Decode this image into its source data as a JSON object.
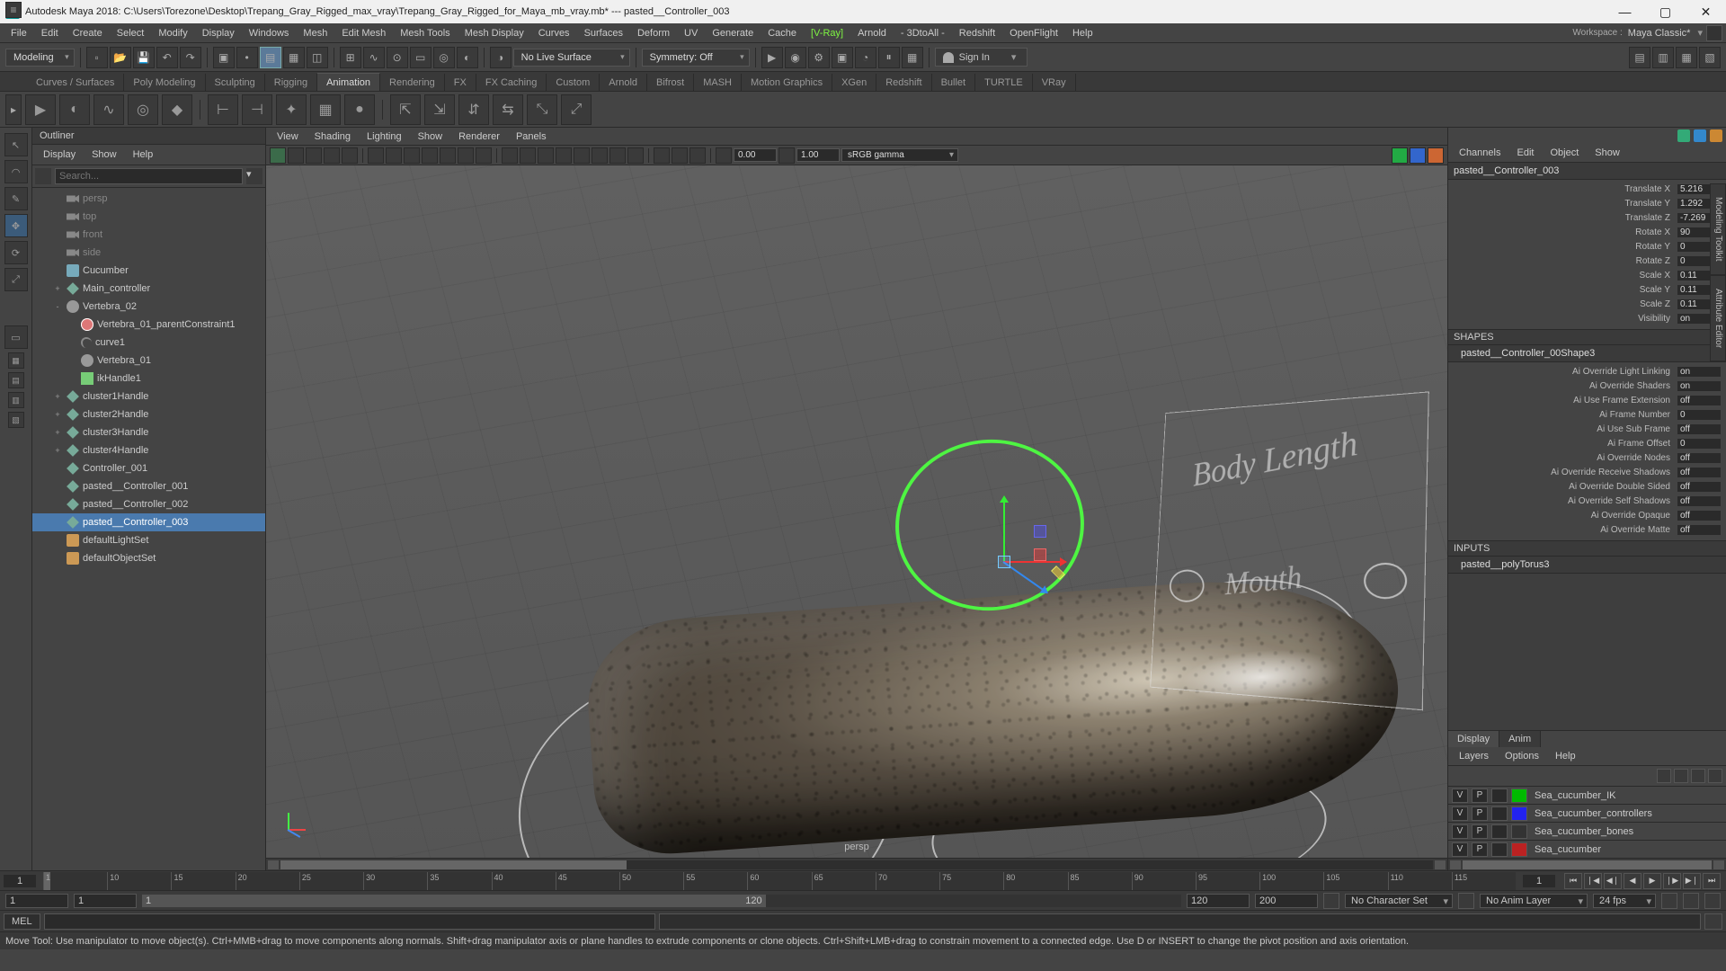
{
  "title": "Autodesk Maya 2018: C:\\Users\\Torezone\\Desktop\\Trepang_Gray_Rigged_max_vray\\Trepang_Gray_Rigged_for_Maya_mb_vray.mb*   ---   pasted__Controller_003",
  "menubar": [
    "File",
    "Edit",
    "Create",
    "Select",
    "Modify",
    "Display",
    "Windows",
    "Mesh",
    "Edit Mesh",
    "Mesh Tools",
    "Mesh Display",
    "Curves",
    "Surfaces",
    "Deform",
    "UV",
    "Generate",
    "Cache",
    "[V-Ray]",
    "Arnold",
    "- 3DtoAll -",
    "Redshift",
    "OpenFlight",
    "Help"
  ],
  "workspace": {
    "label": "Workspace :",
    "value": "Maya Classic*"
  },
  "modeMenu": "Modeling",
  "liveSurface": "No Live Surface",
  "symmetry": "Symmetry: Off",
  "signIn": "Sign In",
  "shelfTabs": [
    "Curves / Surfaces",
    "Poly Modeling",
    "Sculpting",
    "Rigging",
    "Animation",
    "Rendering",
    "FX",
    "FX Caching",
    "Custom",
    "Arnold",
    "Bifrost",
    "MASH",
    "Motion Graphics",
    "XGen",
    "Redshift",
    "Bullet",
    "TURTLE",
    "VRay"
  ],
  "shelfActive": "Animation",
  "outliner": {
    "title": "Outliner",
    "menu": [
      "Display",
      "Show",
      "Help"
    ],
    "searchPlaceholder": "Search...",
    "nodes": [
      {
        "icon": "cam",
        "label": "persp",
        "dim": true,
        "indent": 1
      },
      {
        "icon": "cam",
        "label": "top",
        "dim": true,
        "indent": 1
      },
      {
        "icon": "cam",
        "label": "front",
        "dim": true,
        "indent": 1
      },
      {
        "icon": "cam",
        "label": "side",
        "dim": true,
        "indent": 1
      },
      {
        "icon": "mesh",
        "label": "Cucumber",
        "indent": 1
      },
      {
        "icon": "loc",
        "label": "Main_controller",
        "indent": 1,
        "exp": "+"
      },
      {
        "icon": "jnt",
        "label": "Vertebra_02",
        "indent": 1,
        "exp": "-"
      },
      {
        "icon": "con",
        "label": "Vertebra_01_parentConstraint1",
        "indent": 2
      },
      {
        "icon": "crv",
        "label": "curve1",
        "indent": 2
      },
      {
        "icon": "jnt",
        "label": "Vertebra_01",
        "indent": 2
      },
      {
        "icon": "ik",
        "label": "ikHandle1",
        "indent": 2
      },
      {
        "icon": "loc",
        "label": "cluster1Handle",
        "indent": 1,
        "exp": "+"
      },
      {
        "icon": "loc",
        "label": "cluster2Handle",
        "indent": 1,
        "exp": "+"
      },
      {
        "icon": "loc",
        "label": "cluster3Handle",
        "indent": 1,
        "exp": "+"
      },
      {
        "icon": "loc",
        "label": "cluster4Handle",
        "indent": 1,
        "exp": "+"
      },
      {
        "icon": "loc",
        "label": "Controller_001",
        "indent": 1
      },
      {
        "icon": "loc",
        "label": "pasted__Controller_001",
        "indent": 1
      },
      {
        "icon": "loc",
        "label": "pasted__Controller_002",
        "indent": 1
      },
      {
        "icon": "loc",
        "label": "pasted__Controller_003",
        "indent": 1,
        "sel": true
      },
      {
        "icon": "set",
        "label": "defaultLightSet",
        "indent": 1
      },
      {
        "icon": "set",
        "label": "defaultObjectSet",
        "indent": 1
      }
    ]
  },
  "viewportMenu": [
    "View",
    "Shading",
    "Lighting",
    "Show",
    "Renderer",
    "Panels"
  ],
  "viewportFields": {
    "f1": "0.00",
    "f2": "1.00",
    "colorspace": "sRGB gamma"
  },
  "viewportLabels": {
    "bodyLength": "Body Length",
    "mouth": "Mouth"
  },
  "viewportCamera": "persp",
  "channelBox": {
    "menu": [
      "Channels",
      "Edit",
      "Object",
      "Show"
    ],
    "node": "pasted__Controller_003",
    "attrs": [
      {
        "n": "Translate X",
        "v": "5.216"
      },
      {
        "n": "Translate Y",
        "v": "1.292"
      },
      {
        "n": "Translate Z",
        "v": "-7.269"
      },
      {
        "n": "Rotate X",
        "v": "90"
      },
      {
        "n": "Rotate Y",
        "v": "0"
      },
      {
        "n": "Rotate Z",
        "v": "0"
      },
      {
        "n": "Scale X",
        "v": "0.11"
      },
      {
        "n": "Scale Y",
        "v": "0.11"
      },
      {
        "n": "Scale Z",
        "v": "0.11"
      },
      {
        "n": "Visibility",
        "v": "on"
      }
    ],
    "shapesHeader": "SHAPES",
    "shapeNode": "pasted__Controller_00Shape3",
    "shapeAttrs": [
      {
        "n": "Ai Override Light Linking",
        "v": "on"
      },
      {
        "n": "Ai Override Shaders",
        "v": "on"
      },
      {
        "n": "Ai Use Frame Extension",
        "v": "off"
      },
      {
        "n": "Ai Frame Number",
        "v": "0"
      },
      {
        "n": "Ai Use Sub Frame",
        "v": "off"
      },
      {
        "n": "Ai Frame Offset",
        "v": "0"
      },
      {
        "n": "Ai Override Nodes",
        "v": "off"
      },
      {
        "n": "Ai Override Receive Shadows",
        "v": "off"
      },
      {
        "n": "Ai Override Double Sided",
        "v": "off"
      },
      {
        "n": "Ai Override Self Shadows",
        "v": "off"
      },
      {
        "n": "Ai Override Opaque",
        "v": "off"
      },
      {
        "n": "Ai Override Matte",
        "v": "off"
      }
    ],
    "inputsHeader": "INPUTS",
    "inputNode": "pasted__polyTorus3"
  },
  "layerTabs": {
    "display": "Display",
    "anim": "Anim"
  },
  "layerMenu": [
    "Layers",
    "Options",
    "Help"
  ],
  "layers": [
    {
      "name": "Sea_cucumber_IK",
      "color": "#0b0"
    },
    {
      "name": "Sea_cucumber_controllers",
      "color": "#22e"
    },
    {
      "name": "Sea_cucumber_bones",
      "color": "#333"
    },
    {
      "name": "Sea_cucumber",
      "color": "#b22"
    }
  ],
  "layerCell": {
    "v": "V",
    "p": "P"
  },
  "timeTicks": [
    "1",
    "10",
    "15",
    "20",
    "25",
    "30",
    "35",
    "40",
    "45",
    "50",
    "55",
    "60",
    "65",
    "70",
    "75",
    "80",
    "85",
    "90",
    "95",
    "100",
    "105",
    "110",
    "115"
  ],
  "timeCurrent": "1",
  "timeEnd": "1",
  "range": {
    "startOuter": "1",
    "startInner": "1",
    "endInner": "120",
    "endOuter": "120",
    "end2": "200"
  },
  "charSet": "No Character Set",
  "animLayer": "No Anim Layer",
  "fps": "24 fps",
  "cmdLabel": "MEL",
  "helpLine": "Move Tool: Use manipulator to move object(s). Ctrl+MMB+drag to move components along normals. Shift+drag manipulator axis or plane handles to extrude components or clone objects. Ctrl+Shift+LMB+drag to constrain movement to a connected edge. Use D or INSERT to change the pivot position and axis orientation.",
  "rightTabs": [
    "Modeling Toolkit",
    "Attribute Editor"
  ]
}
